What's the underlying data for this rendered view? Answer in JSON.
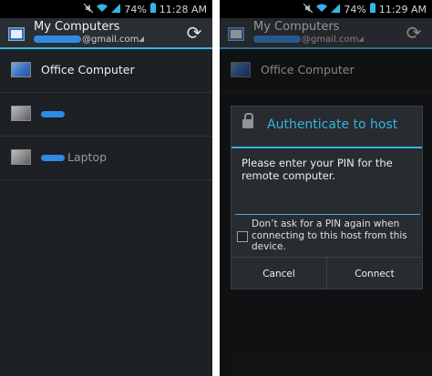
{
  "status": {
    "left": {
      "battery": "74%",
      "time": "11:28 AM"
    },
    "right": {
      "battery": "74%",
      "time": "11:29 AM"
    }
  },
  "app": {
    "title": "My Computers",
    "account_domain": "@gmail.com"
  },
  "computers": [
    {
      "label": "Office Computer",
      "online": true
    },
    {
      "label": "",
      "online": false
    },
    {
      "label": "Laptop",
      "online": false
    }
  ],
  "dialog": {
    "title": "Authenticate to host",
    "message": "Please enter your PIN for the remote computer.",
    "pin_value": "",
    "checkbox_label": "Don’t ask for a PIN again when connecting to this host from this device.",
    "checkbox_checked": false,
    "cancel_label": "Cancel",
    "connect_label": "Connect"
  },
  "colors": {
    "accent": "#33b5e5",
    "background": "#1d2024"
  }
}
